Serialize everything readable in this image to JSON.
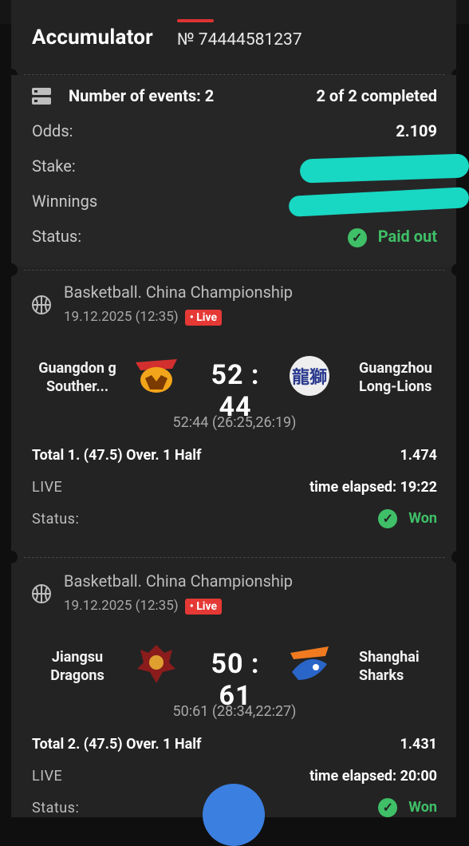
{
  "ticket": {
    "title": "Accumulator",
    "number": "№ 74444581237",
    "events_label": "Number of events: 2",
    "completed": "2 of 2 completed",
    "odds_label": "Odds:",
    "odds_value": "2.109",
    "stake_label": "Stake:",
    "winnings_label": "Winnings",
    "status_label": "Status:",
    "status_value": "Paid out"
  },
  "events": [
    {
      "league": "Basketball. China Championship",
      "date": "19.12.2025 (12:35)",
      "live_badge": "• Live",
      "team1": "Guangdon g Souther...",
      "team2": "Guangzhou Long-Lions",
      "score": "52 : 44",
      "subscore": "52:44 (26:25,26:19)",
      "bet": "Total 1. (47.5) Over. 1 Half",
      "bet_odds": "1.474",
      "live_label": "LIVE",
      "elapsed": "time elapsed: 19:22",
      "status_label": "Status:",
      "status_value": "Won"
    },
    {
      "league": "Basketball. China Championship",
      "date": "19.12.2025 (12:35)",
      "live_badge": "• Live",
      "team1": "Jiangsu Dragons",
      "team2": "Shanghai Sharks",
      "score": "50 : 61",
      "subscore": "50:61 (28:34,22:27)",
      "bet": "Total 2. (47.5) Over. 1 Half",
      "bet_odds": "1.431",
      "live_label": "LIVE",
      "elapsed": "time elapsed: 20:00",
      "status_label": "Status:",
      "status_value": "Won"
    }
  ],
  "colors": {
    "background": "#0f0f0f",
    "card": "#232323",
    "win_green": "#3fbf67",
    "live_red": "#e53935",
    "redaction": "#18d7c3"
  }
}
